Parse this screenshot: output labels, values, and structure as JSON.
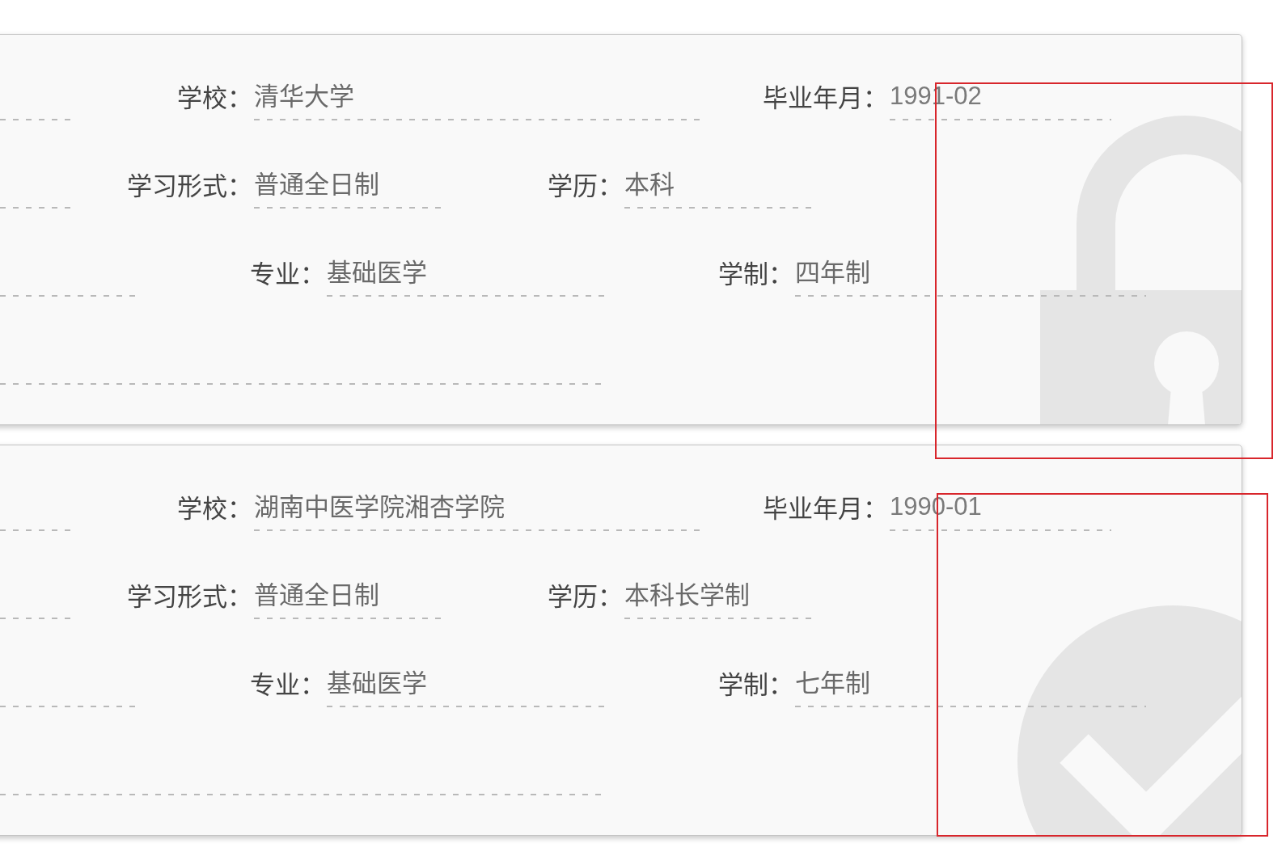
{
  "education_records": [
    {
      "kind": "locked",
      "annotated": true,
      "rows": [
        {
          "fields": [
            {
              "kind": "partial"
            },
            {
              "kind": "labeled",
              "label": "学校：",
              "value": "清华大学"
            },
            {
              "kind": "labeled",
              "label": "毕业年月：",
              "value": "1991-02"
            }
          ]
        },
        {
          "fields": [
            {
              "kind": "partial"
            },
            {
              "kind": "labeled",
              "label": "学习形式：",
              "value": "普通全日制"
            },
            {
              "kind": "labeled",
              "label": "学历：",
              "value": "本科"
            }
          ]
        },
        {
          "fields": [
            {
              "kind": "partial"
            },
            {
              "kind": "labeled",
              "label": "专业：",
              "value": "基础医学"
            },
            {
              "kind": "labeled",
              "label": "学制：",
              "value": "四年制"
            }
          ]
        },
        {
          "fields": [
            {
              "kind": "partial"
            }
          ]
        }
      ]
    },
    {
      "kind": "verified",
      "annotated": true,
      "rows": [
        {
          "fields": [
            {
              "kind": "partial"
            },
            {
              "kind": "labeled",
              "label": "学校：",
              "value": "湖南中医学院湘杏学院"
            },
            {
              "kind": "labeled",
              "label": "毕业年月：",
              "value": "1990-01"
            }
          ]
        },
        {
          "fields": [
            {
              "kind": "partial"
            },
            {
              "kind": "labeled",
              "label": "学习形式：",
              "value": "普通全日制"
            },
            {
              "kind": "labeled",
              "label": "学历：",
              "value": "本科长学制"
            }
          ]
        },
        {
          "fields": [
            {
              "kind": "partial"
            },
            {
              "kind": "labeled",
              "label": "专业：",
              "value": "基础医学"
            },
            {
              "kind": "labeled",
              "label": "学制：",
              "value": "七年制"
            }
          ]
        },
        {
          "fields": [
            {
              "kind": "partial"
            }
          ]
        }
      ]
    }
  ]
}
